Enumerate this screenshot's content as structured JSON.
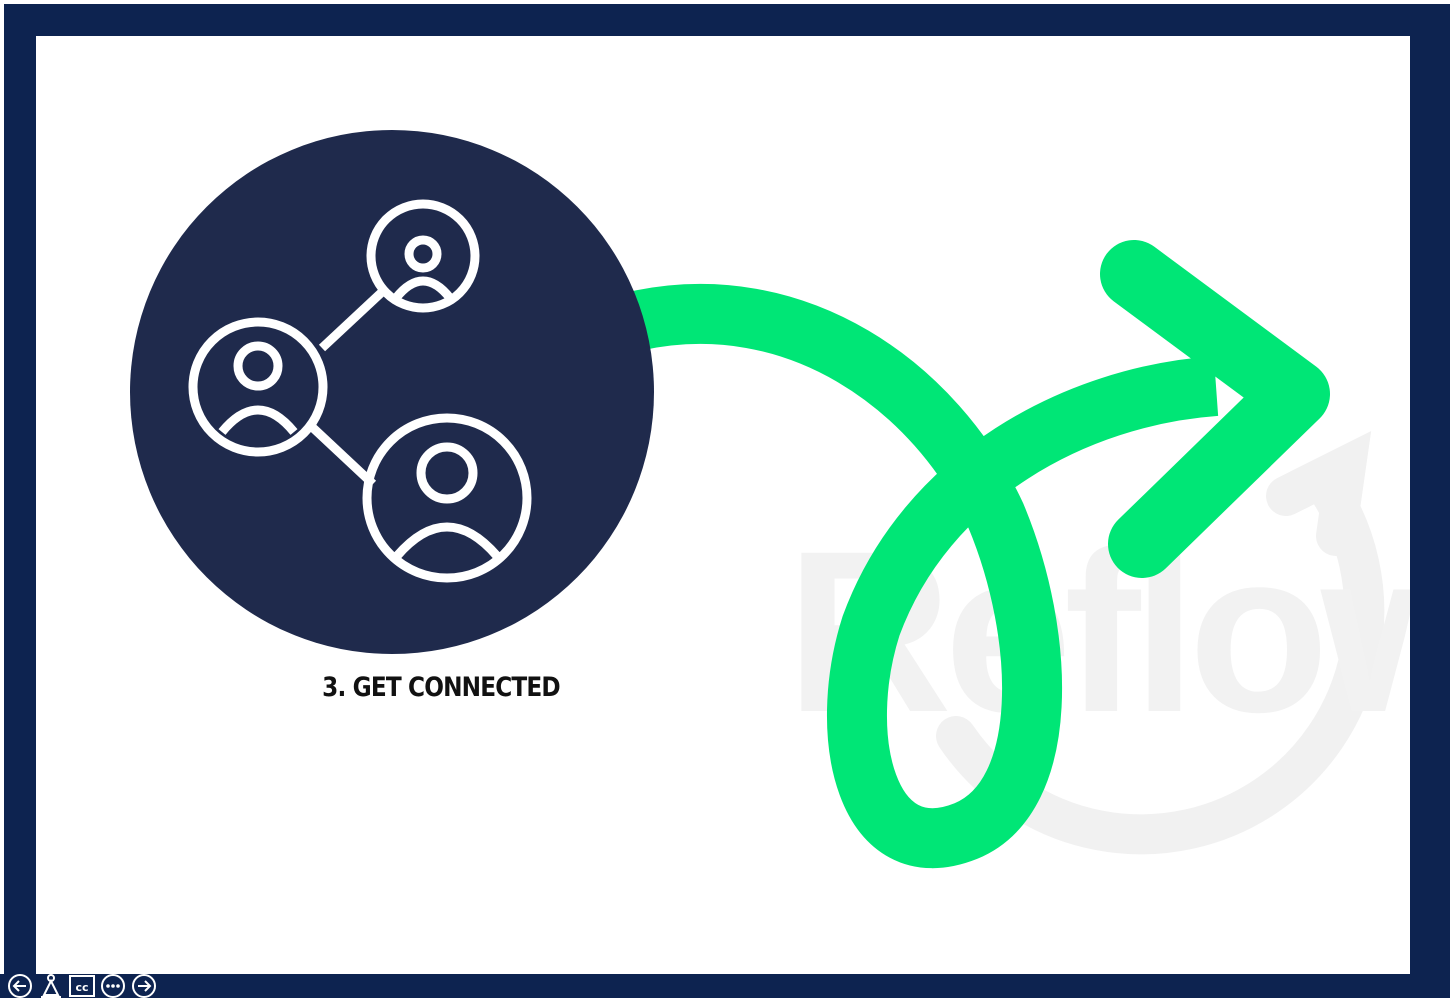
{
  "slide": {
    "caption": "3. GET CONNECTED",
    "watermark": "Reflow",
    "icon": "people-network-icon",
    "colors": {
      "border": "#0d2350",
      "circle": "#1f2a4c",
      "arrow": "#00e676",
      "watermark": "#f2f2f2",
      "caption": "#111111"
    }
  },
  "player_controls": {
    "buttons": [
      {
        "icon": "previous-arrow-icon"
      },
      {
        "icon": "accessibility-icon"
      },
      {
        "icon": "closed-captions-icon",
        "label": "cc"
      },
      {
        "icon": "more-options-icon"
      },
      {
        "icon": "next-arrow-icon"
      }
    ]
  }
}
